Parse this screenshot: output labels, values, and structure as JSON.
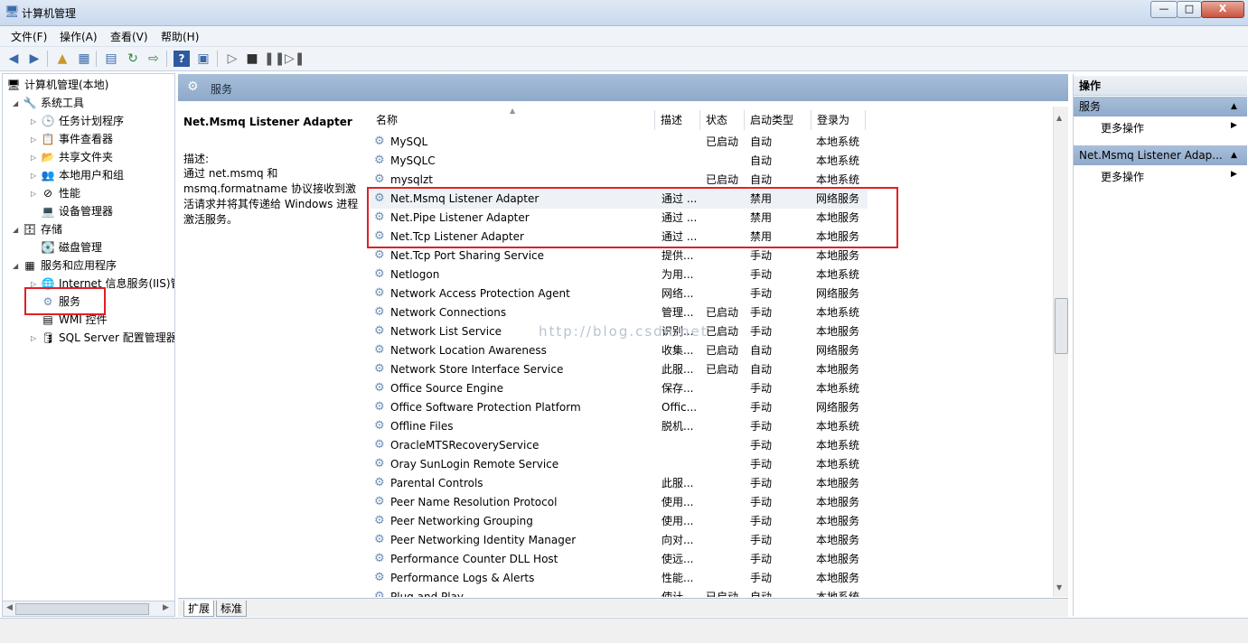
{
  "window": {
    "title": "计算机管理",
    "blurred_tabs": "...",
    "buttons": {
      "minimize": "—",
      "maximize": "□",
      "close": "X"
    }
  },
  "menu": [
    "文件(F)",
    "操作(A)",
    "查看(V)",
    "帮助(H)"
  ],
  "tree": {
    "root": "计算机管理(本地)",
    "system_tools": "系统工具",
    "task_scheduler": "任务计划程序",
    "event_viewer": "事件查看器",
    "shared_folders": "共享文件夹",
    "local_users": "本地用户和组",
    "performance": "性能",
    "device_manager": "设备管理器",
    "storage": "存储",
    "disk_management": "磁盘管理",
    "services_apps": "服务和应用程序",
    "iis": "Internet 信息服务(IIS)管",
    "services": "服务",
    "wmi": "WMI 控件",
    "sql_config": "SQL Server 配置管理器"
  },
  "center": {
    "header_title": "服务",
    "selected_name": "Net.Msmq Listener Adapter",
    "desc_label": "描述:",
    "desc_text": "通过 net.msmq 和 msmq.formatname 协议接收到激活请求并将其传递给 Windows 进程激活服务。",
    "watermark": "http://blog.csdn.net"
  },
  "columns": {
    "name": "名称",
    "desc": "描述",
    "status": "状态",
    "startup": "启动类型",
    "logon": "登录为"
  },
  "rows": [
    {
      "name": "MySQL",
      "desc": "",
      "status": "已启动",
      "startup": "自动",
      "logon": "本地系统"
    },
    {
      "name": "MySQLC",
      "desc": "",
      "status": "",
      "startup": "自动",
      "logon": "本地系统"
    },
    {
      "name": "mysqlzt",
      "desc": "",
      "status": "已启动",
      "startup": "自动",
      "logon": "本地系统"
    },
    {
      "name": "Net.Msmq Listener Adapter",
      "desc": "通过 ...",
      "status": "",
      "startup": "禁用",
      "logon": "网络服务"
    },
    {
      "name": "Net.Pipe Listener Adapter",
      "desc": "通过 ...",
      "status": "",
      "startup": "禁用",
      "logon": "本地服务"
    },
    {
      "name": "Net.Tcp Listener Adapter",
      "desc": "通过 ...",
      "status": "",
      "startup": "禁用",
      "logon": "本地服务"
    },
    {
      "name": "Net.Tcp Port Sharing Service",
      "desc": "提供...",
      "status": "",
      "startup": "手动",
      "logon": "本地服务"
    },
    {
      "name": "Netlogon",
      "desc": "为用...",
      "status": "",
      "startup": "手动",
      "logon": "本地系统"
    },
    {
      "name": "Network Access Protection Agent",
      "desc": "网络...",
      "status": "",
      "startup": "手动",
      "logon": "网络服务"
    },
    {
      "name": "Network Connections",
      "desc": "管理...",
      "status": "已启动",
      "startup": "手动",
      "logon": "本地系统"
    },
    {
      "name": "Network List Service",
      "desc": "识别...",
      "status": "已启动",
      "startup": "手动",
      "logon": "本地服务"
    },
    {
      "name": "Network Location Awareness",
      "desc": "收集...",
      "status": "已启动",
      "startup": "自动",
      "logon": "网络服务"
    },
    {
      "name": "Network Store Interface Service",
      "desc": "此服...",
      "status": "已启动",
      "startup": "自动",
      "logon": "本地服务"
    },
    {
      "name": "Office  Source Engine",
      "desc": "保存...",
      "status": "",
      "startup": "手动",
      "logon": "本地系统"
    },
    {
      "name": "Office Software Protection Platform",
      "desc": "Offic...",
      "status": "",
      "startup": "手动",
      "logon": "网络服务"
    },
    {
      "name": "Offline Files",
      "desc": "脱机...",
      "status": "",
      "startup": "手动",
      "logon": "本地系统"
    },
    {
      "name": "OracleMTSRecoveryService",
      "desc": "",
      "status": "",
      "startup": "手动",
      "logon": "本地系统"
    },
    {
      "name": "Oray SunLogin Remote Service",
      "desc": "",
      "status": "",
      "startup": "手动",
      "logon": "本地系统"
    },
    {
      "name": "Parental Controls",
      "desc": "此服...",
      "status": "",
      "startup": "手动",
      "logon": "本地服务"
    },
    {
      "name": "Peer Name Resolution Protocol",
      "desc": "使用...",
      "status": "",
      "startup": "手动",
      "logon": "本地服务"
    },
    {
      "name": "Peer Networking Grouping",
      "desc": "使用...",
      "status": "",
      "startup": "手动",
      "logon": "本地服务"
    },
    {
      "name": "Peer Networking Identity Manager",
      "desc": "向对...",
      "status": "",
      "startup": "手动",
      "logon": "本地服务"
    },
    {
      "name": "Performance Counter DLL Host",
      "desc": "使远...",
      "status": "",
      "startup": "手动",
      "logon": "本地服务"
    },
    {
      "name": "Performance Logs & Alerts",
      "desc": "性能...",
      "status": "",
      "startup": "手动",
      "logon": "本地服务"
    },
    {
      "name": "Plug and Play",
      "desc": "使计...",
      "status": "已启动",
      "startup": "自动",
      "logon": "本地系统"
    }
  ],
  "tabs": {
    "extended": "扩展",
    "standard": "标准"
  },
  "actions": {
    "header": "操作",
    "section1": "服务",
    "more1": "更多操作",
    "section2": "Net.Msmq Listener Adap...",
    "more2": "更多操作"
  },
  "colors": {
    "highlight": "#e11f26",
    "header_blue": "#9bb4d2"
  }
}
